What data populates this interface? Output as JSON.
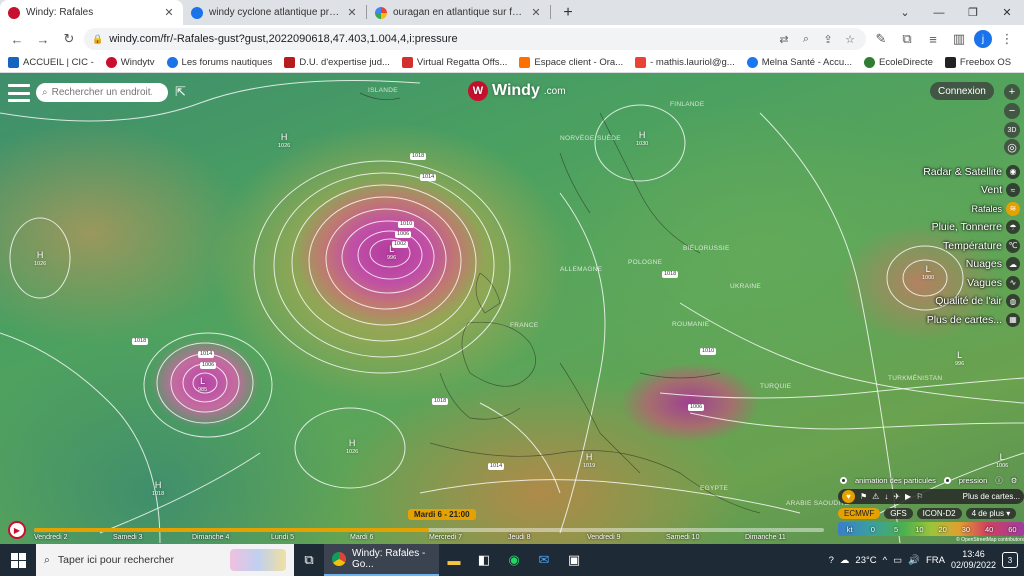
{
  "tabs": [
    {
      "title": "Windy: Rafales",
      "active": true,
      "color": "#c8102e"
    },
    {
      "title": "windy cyclone atlantique projecti",
      "active": false,
      "color": "#1a73e8"
    },
    {
      "title": "ouragan en atlantique sur france",
      "active": false,
      "color": "#4285f4"
    }
  ],
  "address": {
    "url": "windy.com/fr/-Rafales-gust?gust,2022090618,47.403,1.004,4,i:pressure"
  },
  "profile_initial": "j",
  "bookmarks": [
    {
      "label": "ACCUEIL | CIC -",
      "color": "#1565c0"
    },
    {
      "label": "Windytv",
      "color": "#c8102e"
    },
    {
      "label": "Les forums nautiques",
      "color": "#1a73e8"
    },
    {
      "label": "D.U. d'expertise jud...",
      "color": "#b71c1c"
    },
    {
      "label": "Virtual Regatta Offs...",
      "color": "#d32f2f"
    },
    {
      "label": "Espace client - Ora...",
      "color": "#ff6f00"
    },
    {
      "label": "- mathis.lauriol@g...",
      "color": "#ea4335"
    },
    {
      "label": "Melna Santé - Accu...",
      "color": "#1877f2"
    },
    {
      "label": "EcoleDirecte",
      "color": "#2e7d32"
    },
    {
      "label": "Freebox OS",
      "color": "#222222"
    }
  ],
  "map": {
    "search_placeholder": "Rechercher un endroit...",
    "logo": "Windy",
    "logo_suffix": ".com",
    "connexion": "Connexion",
    "zoom_in": "+",
    "zoom_out": "−",
    "view_3d": "3D",
    "layers": [
      {
        "label": "Radar & Satellite",
        "icon": "◉",
        "active": false
      },
      {
        "label": "Vent",
        "icon": "≈",
        "active": false
      },
      {
        "label": "Rafales",
        "icon": "≋",
        "active": true,
        "small": true
      },
      {
        "label": "Pluie, Tonnerre",
        "icon": "☂",
        "active": false
      },
      {
        "label": "Température",
        "icon": "℃",
        "active": false
      },
      {
        "label": "Nuages",
        "icon": "☁",
        "active": false
      },
      {
        "label": "Vagues",
        "icon": "∿",
        "active": false
      },
      {
        "label": "Qualité de l'air",
        "icon": "◍",
        "active": false
      },
      {
        "label": "Plus de cartes...",
        "icon": "▦",
        "active": false
      }
    ],
    "place_labels": [
      {
        "text": "ISLANDE"
      },
      {
        "text": "FINLANDE"
      },
      {
        "text": "NORVÈGE"
      },
      {
        "text": "SUÈDE"
      },
      {
        "text": "ALLEMAGNE"
      },
      {
        "text": "POLOGNE"
      },
      {
        "text": "BIÉLORUSSIE"
      },
      {
        "text": "UKRAINE"
      },
      {
        "text": "FRANCE"
      },
      {
        "text": "ROUMANIE"
      },
      {
        "text": "TURQUIE"
      },
      {
        "text": "EGYPTE"
      },
      {
        "text": "ARABIE SAOUDITE"
      },
      {
        "text": "TURKMÉNISTAN"
      }
    ],
    "pressure_centers": [
      {
        "letter": "H",
        "value": "1026"
      },
      {
        "letter": "H",
        "value": "1030"
      },
      {
        "letter": "H",
        "value": "1026"
      },
      {
        "letter": "L",
        "value": "996"
      },
      {
        "letter": "L",
        "value": "985"
      },
      {
        "letter": "H",
        "value": "1026"
      },
      {
        "letter": "H",
        "value": "1018"
      },
      {
        "letter": "H",
        "value": "1019"
      },
      {
        "letter": "L",
        "value": "1000"
      },
      {
        "letter": "L",
        "value": "996"
      },
      {
        "letter": "L",
        "value": "1006"
      }
    ],
    "isobar_labels": [
      "1018",
      "1014",
      "1010",
      "1006",
      "1002",
      "1018",
      "1014",
      "1006",
      "1018",
      "1014",
      "1018",
      "1006",
      "1010"
    ]
  },
  "panel": {
    "particles": "animation des particules",
    "pressure": "pression",
    "more_layers": "Plus de cartes...",
    "models": [
      "ECMWF",
      "GFS",
      "ICON-D2",
      "4 de plus ▾"
    ],
    "selected_model": "ECMWF",
    "legend_unit": "kt",
    "legend_values": [
      "0",
      "5",
      "10",
      "20",
      "30",
      "40",
      "60"
    ],
    "attribution": "© OpenStreetMap contributors"
  },
  "timeline": {
    "current": "Mardi 6 - 21:00",
    "days": [
      "Vendredi 2",
      "Samedi 3",
      "Dimanche 4",
      "Lundi 5",
      "Mardi 6",
      "Mercredi 7",
      "Jeudi 8",
      "Vendredi 9",
      "Samedi 10",
      "Dimanche 11"
    ],
    "progress": 0.5
  },
  "taskbar": {
    "search_placeholder": "Taper ici pour rechercher",
    "active_app": "Windy: Rafales - Go...",
    "temperature": "23°C",
    "language": "FRA",
    "time": "13:46",
    "date": "02/09/2022",
    "notifications": "3"
  }
}
